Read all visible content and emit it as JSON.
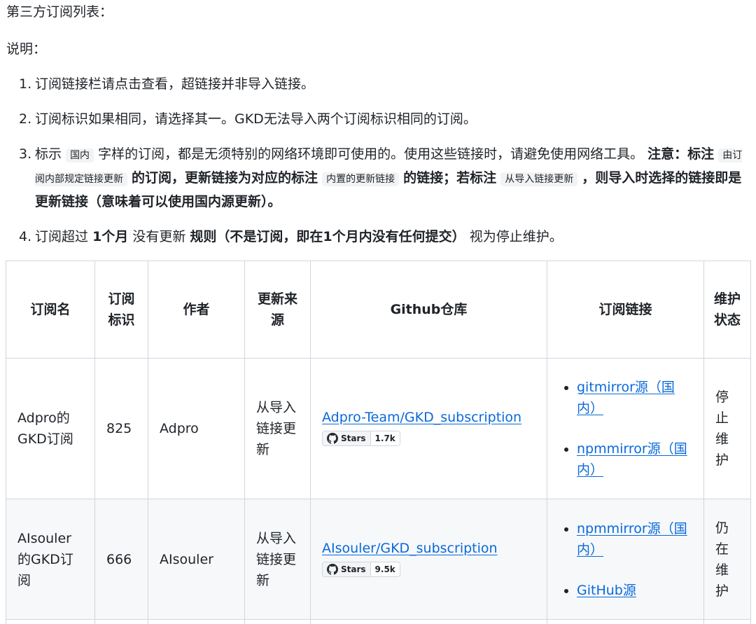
{
  "doc": {
    "title": "第三方订阅列表：",
    "note_label": "说明：",
    "rules": [
      {
        "num": "1.",
        "text": "订阅链接栏请点击查看，超链接并非导入链接。"
      },
      {
        "num": "2.",
        "text": "订阅标识如果相同，请选择其一。GKD无法导入两个订阅标识相同的订阅。"
      },
      {
        "num": "3.",
        "t1": "标示",
        "tag_domestic": "国内",
        "t2": "字样的订阅，都是无须特别的网络环境即可使用的。使用这些链接时，请避免使用网络工具。",
        "b1": "注意：标注",
        "tag_internal": "由订阅内部规定链接更新",
        "b2": "的订阅，更新链接为对应的标注",
        "tag_builtin": "内置的更新链接",
        "b3": "的链接；若标注",
        "tag_import": "从导入链接更新",
        "b4": "，则导入时选择的链接即是更新链接（意味着可以使用国内源更新）。"
      },
      {
        "num": "4.",
        "t1": "订阅超过",
        "b1": "1个月",
        "t2": "没有更新",
        "b2": "规则（不是订阅，即在1个月内没有任何提交）",
        "t3": "视为停止维护。"
      }
    ]
  },
  "table": {
    "headers": {
      "name": "订阅名",
      "id": "订阅标识",
      "author": "作者",
      "source": "更新来源",
      "repo": "Github仓库",
      "links": "订阅链接",
      "status": "维护状态"
    },
    "rows": [
      {
        "name": "Adpro的GKD订阅",
        "id": "825",
        "author": "Adpro",
        "source": "从导入链接更新",
        "repo": "Adpro-Team/GKD_subscription",
        "badge_label": "Stars",
        "badge_count": "1.7k",
        "links": [
          "gitmirror源（国内）",
          "npmmirror源（国内）"
        ],
        "status": "停止维护"
      },
      {
        "name": "AIsouler的GKD订阅",
        "id": "666",
        "author": "AIsouler",
        "source": "从导入链接更新",
        "repo": "AIsouler/GKD_subscription",
        "badge_label": "Stars",
        "badge_count": "9.5k",
        "links": [
          "npmmirror源（国内）",
          "GitHub源"
        ],
        "status": "仍在维护"
      }
    ]
  },
  "colors": {
    "link": "#0969da",
    "border": "#d0d7de",
    "stripe": "#f6f8fa",
    "text": "#1f2328"
  }
}
